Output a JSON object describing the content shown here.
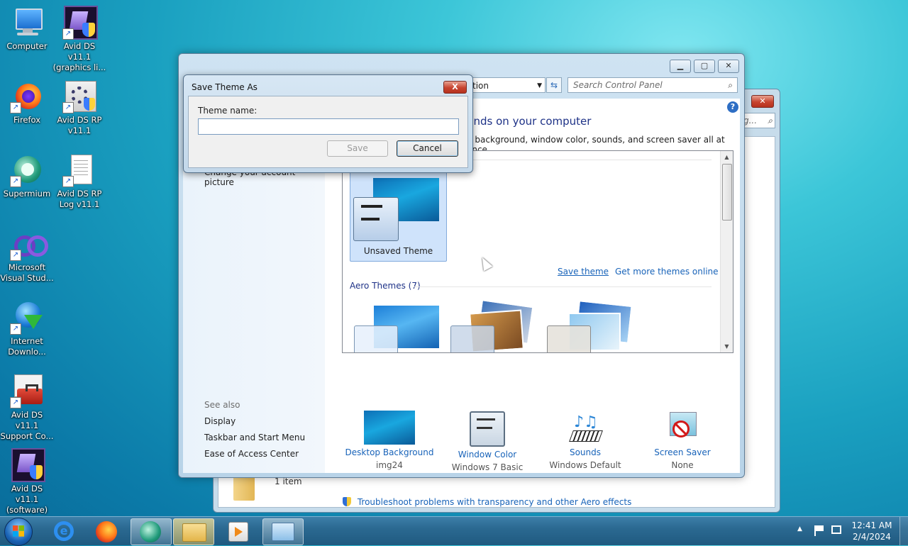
{
  "desktop": {
    "icons": [
      {
        "label": "Computer",
        "icon": "computer-icon"
      },
      {
        "label": "Avid DS v11.1 (graphics li...",
        "icon": "avid-icon"
      },
      {
        "label": "Firefox",
        "icon": "firefox-icon"
      },
      {
        "label": "Avid DS RP v11.1",
        "icon": "avid-rp-icon"
      },
      {
        "label": "Supermium",
        "icon": "supermium-icon"
      },
      {
        "label": "Avid DS RP Log v11.1",
        "icon": "document-icon"
      },
      {
        "label": "Microsoft Visual Stud...",
        "icon": "visual-studio-icon"
      },
      {
        "label": "Internet Downlo...",
        "icon": "idm-icon"
      },
      {
        "label": "Avid DS v11.1 Support Co...",
        "icon": "toolbox-icon"
      },
      {
        "label": "Avid DS v11.1 (software)",
        "icon": "avid-icon"
      }
    ]
  },
  "main_window": {
    "address_fragment": "tion",
    "search_placeholder": "Search Control Panel",
    "heading_fragment": "unds on your computer",
    "description_fragment": "p background, window color, sounds, and screen saver all at once.",
    "sidebar_fragment": "Change your account picture",
    "see_also": {
      "title": "See also",
      "links": [
        "Display",
        "Taskbar and Start Menu",
        "Ease of Access Center"
      ]
    },
    "my_theme": {
      "label": "Unsaved Theme"
    },
    "save_theme": "Save theme",
    "get_more": "Get more themes online",
    "aero_header": "Aero Themes (7)",
    "bottom": [
      {
        "caption": "Desktop Background",
        "sub": "img24"
      },
      {
        "caption": "Window Color",
        "sub": "Windows 7 Basic"
      },
      {
        "caption": "Sounds",
        "sub": "Windows Default"
      },
      {
        "caption": "Screen Saver",
        "sub": "None"
      }
    ],
    "troubleshoot": "Troubleshoot problems with transparency and other Aero effects"
  },
  "back_window": {
    "search_fragment": "g...",
    "status": "1 item"
  },
  "dialog": {
    "title": "Save Theme As",
    "field_label": "Theme name:",
    "field_value": "",
    "save": "Save",
    "cancel": "Cancel",
    "close": "X"
  },
  "taskbar": {
    "time": "12:41 AM",
    "date": "2/4/2024",
    "tray_arrow": "▲"
  }
}
